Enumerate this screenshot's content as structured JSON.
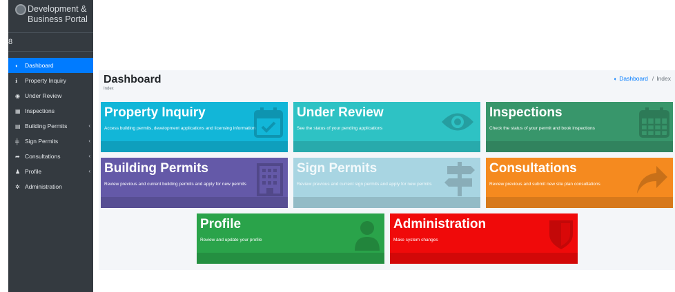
{
  "sidebar": {
    "brand_text": "Development & Business Portal",
    "user_glyph": "8",
    "items": [
      {
        "label": "Dashboard",
        "icon": "tachometer-icon",
        "glyph": "◐",
        "chevron": false,
        "active": true
      },
      {
        "label": "Property Inquiry",
        "icon": "info-circle-icon",
        "glyph": "ℹ",
        "chevron": false,
        "active": false
      },
      {
        "label": "Under Review",
        "icon": "eye-icon",
        "glyph": "◉",
        "chevron": false,
        "active": false
      },
      {
        "label": "Inspections",
        "icon": "calendar-icon",
        "glyph": "▦",
        "chevron": false,
        "active": false
      },
      {
        "label": "Building Permits",
        "icon": "building-icon",
        "glyph": "▤",
        "chevron": true,
        "active": false
      },
      {
        "label": "Sign Permits",
        "icon": "signpost-icon",
        "glyph": "╪",
        "chevron": true,
        "active": false
      },
      {
        "label": "Consultations",
        "icon": "share-icon",
        "glyph": "➦",
        "chevron": true,
        "active": false
      },
      {
        "label": "Profile",
        "icon": "user-icon",
        "glyph": "♟",
        "chevron": true,
        "active": false
      },
      {
        "label": "Administration",
        "icon": "cog-icon",
        "glyph": "✲",
        "chevron": false,
        "active": false
      }
    ],
    "chevron_glyph": "‹"
  },
  "header": {
    "title": "Dashboard",
    "subtitle": "Index",
    "breadcrumb": {
      "icon": "tachometer-icon",
      "link": "Dashboard",
      "separator": "/",
      "current": "Index"
    }
  },
  "tiles": [
    {
      "key": "property_inquiry",
      "title": "Property Inquiry",
      "desc": "Access building permits, development applications and licensing information",
      "color": "#17a2b8",
      "bright": "#12b6d8",
      "icon": "calendar-icon"
    },
    {
      "key": "under_review",
      "title": "Under Review",
      "desc": "See the status of your pending applications",
      "color": "#2ec2c4",
      "icon": "eye-icon"
    },
    {
      "key": "inspections",
      "title": "Inspections",
      "desc": "Check the status of your permit and book inspections",
      "color": "#38966b",
      "icon": "calendar-icon"
    },
    {
      "key": "building_permits",
      "title": "Building Permits",
      "desc": "Review previous and current building permits and apply for new permits",
      "color": "#6459a8",
      "icon": "building-icon"
    },
    {
      "key": "sign_permits",
      "title": "Sign Permits",
      "desc": "Review previous and current sign permits and apply for new permits",
      "color": "#a8d5e2",
      "icon": "signpost-icon"
    },
    {
      "key": "consultations",
      "title": "Consultations",
      "desc": "Review previous and submit new site plan consultations",
      "color": "#f58a1f",
      "icon": "share-icon"
    },
    {
      "key": "profile",
      "title": "Profile",
      "desc": "Review and update your profile",
      "color": "#2aa34a",
      "icon": "user-icon"
    },
    {
      "key": "administration",
      "title": "Administration",
      "desc": "Make system changes",
      "color": "#f00a0a",
      "icon": "shield-icon"
    }
  ]
}
